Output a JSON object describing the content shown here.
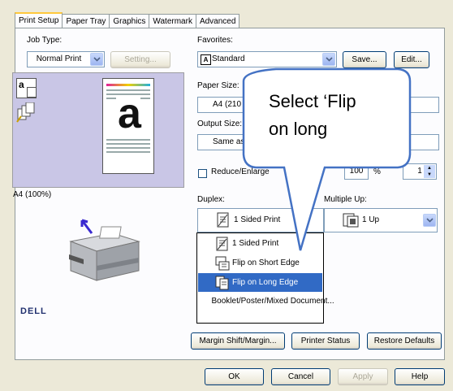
{
  "tabs": [
    "Print Setup",
    "Paper Tray",
    "Graphics",
    "Watermark",
    "Advanced"
  ],
  "job_type": {
    "label": "Job Type:",
    "value": "Normal Print",
    "setting_button": "Setting..."
  },
  "favorites": {
    "label": "Favorites:",
    "value": "Standard",
    "save_button": "Save...",
    "edit_button": "Edit..."
  },
  "preview": {
    "caption": "A4 (100%)",
    "page_letter": "a",
    "thumb_letter": "a"
  },
  "paper_size": {
    "label": "Paper Size:",
    "value": "A4 (210 x"
  },
  "output_size": {
    "label": "Output Size:",
    "value": "Same as"
  },
  "reduce_enlarge": {
    "label": "Reduce/Enlarge",
    "value": "100",
    "unit": "%",
    "copies": "1"
  },
  "duplex": {
    "label": "Duplex:",
    "selected": "1 Sided Print",
    "options": [
      "1 Sided Print",
      "Flip on Short Edge",
      "Flip on Long Edge",
      "Booklet/Poster/Mixed Document..."
    ]
  },
  "multiple_up": {
    "label": "Multiple Up:",
    "value": "1 Up"
  },
  "brand": "DELL",
  "bottom_buttons": {
    "margin_shift": "Margin Shift/Margin...",
    "printer_status": "Printer Status",
    "restore_defaults": "Restore Defaults"
  },
  "dialog_buttons": {
    "ok": "OK",
    "cancel": "Cancel",
    "apply": "Apply",
    "help": "Help"
  },
  "callout": {
    "line1": "Select ‘Flip",
    "line2": "on long"
  },
  "colors": {
    "selection": "#316ac5",
    "preview_bg": "#c9c6e6",
    "callout_stroke": "#4472c4"
  }
}
